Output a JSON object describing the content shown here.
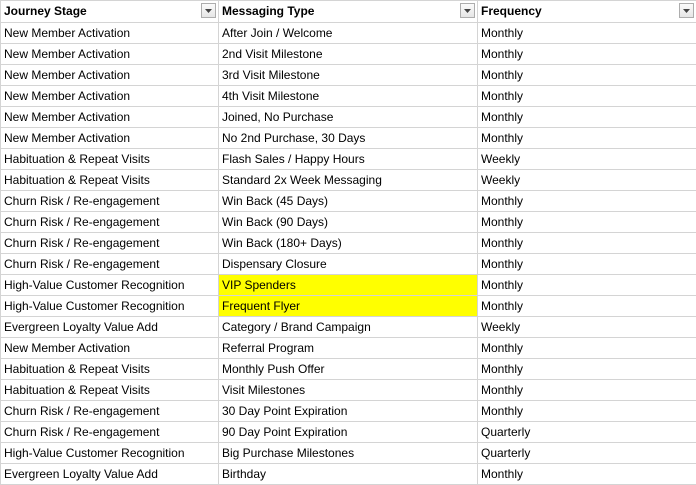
{
  "header": {
    "columns": [
      {
        "label": "Journey Stage"
      },
      {
        "label": "Messaging Type"
      },
      {
        "label": "Frequency"
      }
    ],
    "filter_icon": "dropdown-arrow-icon"
  },
  "colors": {
    "highlight": "#ffff00",
    "gridline": "#d4d4d4"
  },
  "rows": [
    {
      "stage": "New Member Activation",
      "type": "After Join / Welcome",
      "freq": "Monthly",
      "highlight": false
    },
    {
      "stage": "New Member Activation",
      "type": "2nd Visit Milestone",
      "freq": "Monthly",
      "highlight": false
    },
    {
      "stage": "New Member Activation",
      "type": "3rd Visit Milestone",
      "freq": "Monthly",
      "highlight": false
    },
    {
      "stage": "New Member Activation",
      "type": "4th Visit Milestone",
      "freq": "Monthly",
      "highlight": false
    },
    {
      "stage": "New Member Activation",
      "type": "Joined, No Purchase",
      "freq": "Monthly",
      "highlight": false
    },
    {
      "stage": "New Member Activation",
      "type": "No 2nd Purchase, 30 Days",
      "freq": "Monthly",
      "highlight": false
    },
    {
      "stage": "Habituation & Repeat Visits",
      "type": "Flash Sales / Happy Hours",
      "freq": "Weekly",
      "highlight": false
    },
    {
      "stage": "Habituation & Repeat Visits",
      "type": "Standard 2x Week Messaging",
      "freq": "Weekly",
      "highlight": false
    },
    {
      "stage": "Churn Risk / Re-engagement",
      "type": "Win Back (45 Days)",
      "freq": "Monthly",
      "highlight": false
    },
    {
      "stage": "Churn Risk / Re-engagement",
      "type": "Win Back (90 Days)",
      "freq": "Monthly",
      "highlight": false
    },
    {
      "stage": "Churn Risk / Re-engagement",
      "type": "Win Back (180+ Days)",
      "freq": "Monthly",
      "highlight": false
    },
    {
      "stage": "Churn Risk / Re-engagement",
      "type": "Dispensary Closure",
      "freq": "Monthly",
      "highlight": false
    },
    {
      "stage": "High-Value Customer Recognition",
      "type": "VIP Spenders",
      "freq": "Monthly",
      "highlight": true
    },
    {
      "stage": "High-Value Customer Recognition",
      "type": "Frequent Flyer",
      "freq": "Monthly",
      "highlight": true
    },
    {
      "stage": "Evergreen Loyalty Value Add",
      "type": "Category / Brand Campaign",
      "freq": "Weekly",
      "highlight": false
    },
    {
      "stage": "New Member Activation",
      "type": "Referral Program",
      "freq": "Monthly",
      "highlight": false
    },
    {
      "stage": "Habituation & Repeat Visits",
      "type": "Monthly Push Offer",
      "freq": "Monthly",
      "highlight": false
    },
    {
      "stage": "Habituation & Repeat Visits",
      "type": "Visit Milestones",
      "freq": "Monthly",
      "highlight": false
    },
    {
      "stage": "Churn Risk / Re-engagement",
      "type": "30 Day Point Expiration",
      "freq": "Monthly",
      "highlight": false
    },
    {
      "stage": "Churn Risk / Re-engagement",
      "type": "90 Day Point Expiration",
      "freq": "Quarterly",
      "highlight": false
    },
    {
      "stage": "High-Value Customer Recognition",
      "type": "Big Purchase Milestones",
      "freq": "Quarterly",
      "highlight": false
    },
    {
      "stage": "Evergreen Loyalty Value Add",
      "type": "Birthday",
      "freq": "Monthly",
      "highlight": false
    }
  ]
}
